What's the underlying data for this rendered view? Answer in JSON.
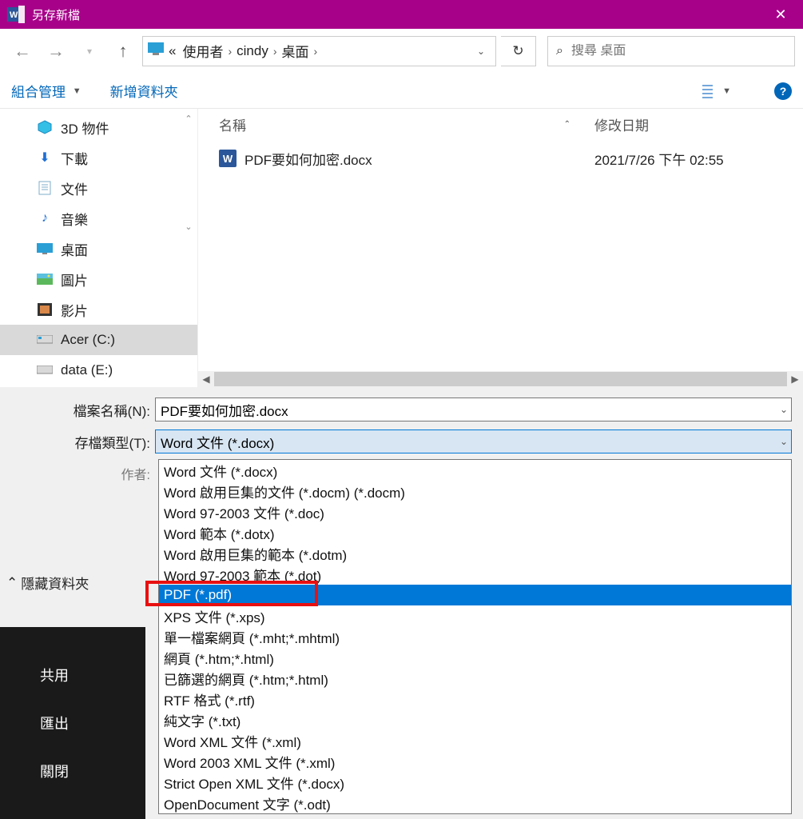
{
  "title": "另存新檔",
  "nav": {
    "crumb_prefix": "«",
    "crumbs": [
      "使用者",
      "cindy",
      "桌面"
    ],
    "search_placeholder": "搜尋 桌面"
  },
  "toolbar": {
    "organize": "組合管理",
    "newfolder": "新增資料夾"
  },
  "tree": [
    {
      "icon": "3d",
      "label": "3D 物件"
    },
    {
      "icon": "dl",
      "label": "下載"
    },
    {
      "icon": "doc",
      "label": "文件"
    },
    {
      "icon": "mus",
      "label": "音樂"
    },
    {
      "icon": "desk",
      "label": "桌面"
    },
    {
      "icon": "pic",
      "label": "圖片"
    },
    {
      "icon": "vid",
      "label": "影片"
    },
    {
      "icon": "drv",
      "label": "Acer (C:)"
    },
    {
      "icon": "drv",
      "label": "data (E:)"
    }
  ],
  "columns": {
    "name": "名稱",
    "date": "修改日期"
  },
  "files": [
    {
      "name": "PDF要如何加密.docx",
      "date": "2021/7/26 下午 02:55"
    }
  ],
  "form": {
    "filename_label": "檔案名稱(N):",
    "filename_value": "PDF要如何加密.docx",
    "type_label": "存檔類型(T):",
    "type_value": "Word 文件 (*.docx)",
    "author_label": "作者:"
  },
  "options": [
    "Word 文件 (*.docx)",
    "Word 啟用巨集的文件 (*.docm) (*.docm)",
    "Word 97-2003 文件 (*.doc)",
    "Word 範本 (*.dotx)",
    "Word 啟用巨集的範本 (*.dotm)",
    "Word 97-2003 範本 (*.dot)",
    "PDF (*.pdf)",
    "XPS 文件 (*.xps)",
    "單一檔案網頁 (*.mht;*.mhtml)",
    "網頁 (*.htm;*.html)",
    "已篩選的網頁 (*.htm;*.html)",
    "RTF 格式 (*.rtf)",
    "純文字 (*.txt)",
    "Word XML 文件 (*.xml)",
    "Word 2003 XML 文件 (*.xml)",
    "Strict Open XML 文件 (*.docx)",
    "OpenDocument 文字 (*.odt)"
  ],
  "highlight_option_index": 6,
  "hide_folders": "隱藏資料夾",
  "dark_items": [
    "共用",
    "匯出",
    "關閉"
  ]
}
